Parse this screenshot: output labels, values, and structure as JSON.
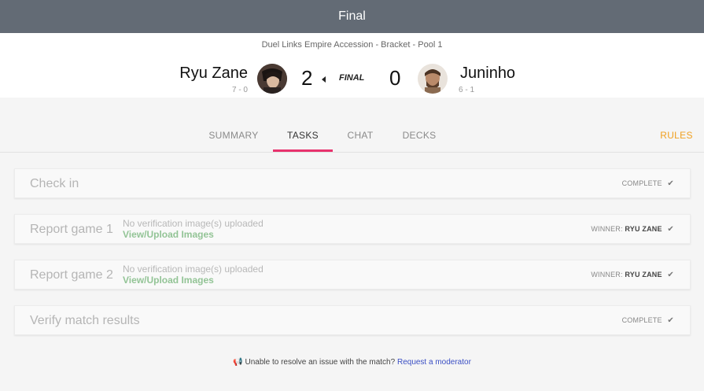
{
  "topbar": {
    "title": "Final"
  },
  "match": {
    "tournament": "Duel Links Empire Accession - Bracket - Pool 1",
    "player1": {
      "name": "Ryu Zane",
      "record": "7 - 0",
      "score": "2"
    },
    "player2": {
      "name": "Juninho",
      "record": "6 - 1",
      "score": "0"
    },
    "status_label": "FINAL"
  },
  "tabs": {
    "summary": "SUMMARY",
    "tasks": "TASKS",
    "chat": "CHAT",
    "decks": "DECKS",
    "rules": "RULES"
  },
  "tasks": [
    {
      "title": "Check in",
      "status": "COMPLETE"
    },
    {
      "title": "Report game 1",
      "note": "No verification image(s) uploaded",
      "link": "View/Upload Images",
      "winner_label": "WINNER:",
      "winner": "RYU ZANE"
    },
    {
      "title": "Report game 2",
      "note": "No verification image(s) uploaded",
      "link": "View/Upload Images",
      "winner_label": "WINNER:",
      "winner": "RYU ZANE"
    },
    {
      "title": "Verify match results",
      "status": "COMPLETE"
    }
  ],
  "footer": {
    "text": "Unable to resolve an issue with the match?",
    "link": "Request a moderator"
  },
  "colors": {
    "topbar": "#636b75",
    "tab_active_underline": "#e8336d",
    "rules": "#f0a020",
    "link_green": "#93c496",
    "link_blue": "#3b4fc4"
  }
}
